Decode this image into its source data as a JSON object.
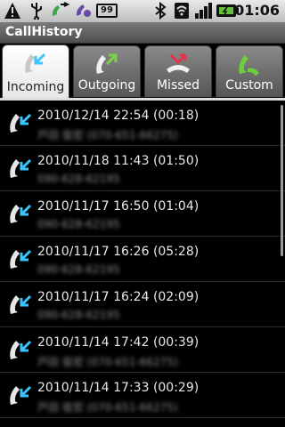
{
  "status_bar": {
    "battery_percent": "99",
    "time": "01:06",
    "icons": [
      "warning-icon",
      "usb-icon",
      "missed-call-icon",
      "phone-settings-icon",
      "battery-percent-icon",
      "bluetooth-icon",
      "wifi-icon",
      "signal-icon",
      "charging-battery-icon"
    ]
  },
  "app": {
    "title": "CallHistory"
  },
  "tabs": [
    {
      "label": "Incoming",
      "active": true
    },
    {
      "label": "Outgoing",
      "active": false
    },
    {
      "label": "Missed",
      "active": false
    },
    {
      "label": "Custom",
      "active": false
    }
  ],
  "calls": [
    {
      "datetime": "2010/12/14 22:54 (00:18)",
      "number": "戸田 俊宏 (070-651-66275)"
    },
    {
      "datetime": "2010/11/18 11:43 (01:50)",
      "number": "090-628-62195"
    },
    {
      "datetime": "2010/11/17 16:50 (01:04)",
      "number": "090-628-62195"
    },
    {
      "datetime": "2010/11/17 16:26 (05:28)",
      "number": "090-628-62195"
    },
    {
      "datetime": "2010/11/17 16:24 (02:09)",
      "number": "090-628-62195"
    },
    {
      "datetime": "2010/11/14 17:42 (00:39)",
      "number": "戸田 俊宏 (070-651-66275)"
    },
    {
      "datetime": "2010/11/14 17:33 (00:29)",
      "number": "戸田 俊宏 (070-651-66275)"
    }
  ],
  "colors": {
    "incoming_arrow": "#39c6ff",
    "outgoing_arrow": "#7fd14b",
    "missed_arrow": "#e8324a",
    "custom_handset": "#6ccf3c"
  }
}
